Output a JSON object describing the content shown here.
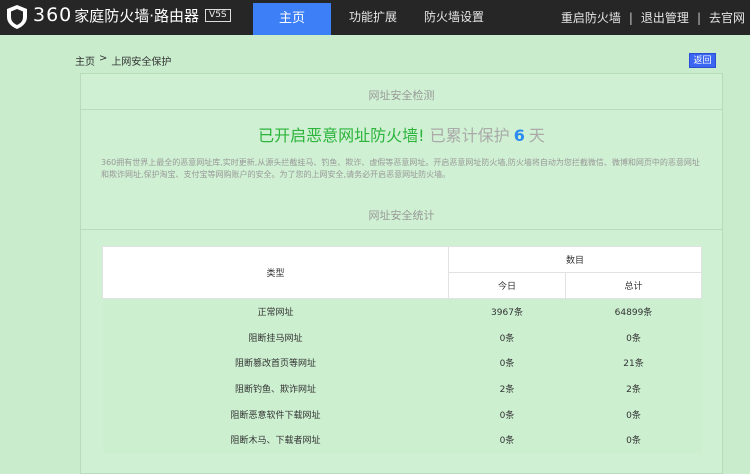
{
  "header": {
    "brand_num": "360",
    "brand_text": "家庭防火墙·路由器",
    "brand_badge": "V5S",
    "tabs": [
      {
        "label": "主页"
      },
      {
        "label": "功能扩展"
      },
      {
        "label": "防火墙设置"
      }
    ],
    "actions": [
      {
        "label": "重启防火墙"
      },
      {
        "label": "退出管理"
      },
      {
        "label": "去官网"
      }
    ],
    "separator": "|"
  },
  "breadcrumb": {
    "home": "主页",
    "sep": ">",
    "current": "上网安全保护"
  },
  "back_label": "返回",
  "detect": {
    "title": "网址安全检测",
    "headline_on": "已开启恶意网址防火墙!",
    "headline_pre": "已累计保护",
    "days": "6",
    "days_unit": "天",
    "description": "360拥有世界上最全的恶意网址库,实时更新,从源头拦截挂马、钓鱼、欺诈、虚假等恶意网址。开启恶意网址防火墙,防火墙将自动为您拦截微信、微博和网页中的恶意网址和欺诈网址,保护淘宝、支付宝等网购账户的安全。为了您的上网安全,请务必开启恶意网址防火墙。"
  },
  "stats": {
    "title": "网址安全统计",
    "col_type": "类型",
    "col_count": "数目",
    "col_today": "今日",
    "col_total": "总计",
    "rows": [
      {
        "type": "正常网址",
        "today": "3967条",
        "total": "64899条"
      },
      {
        "type": "阻断挂马网址",
        "today": "0条",
        "total": "0条"
      },
      {
        "type": "阻断篡改首页等网址",
        "today": "0条",
        "total": "21条"
      },
      {
        "type": "阻断钓鱼、欺诈网址",
        "today": "2条",
        "total": "2条"
      },
      {
        "type": "阻断恶意软件下载网址",
        "today": "0条",
        "total": "0条"
      },
      {
        "type": "阻断木马、下载者网址",
        "today": "0条",
        "total": "0条"
      }
    ]
  }
}
